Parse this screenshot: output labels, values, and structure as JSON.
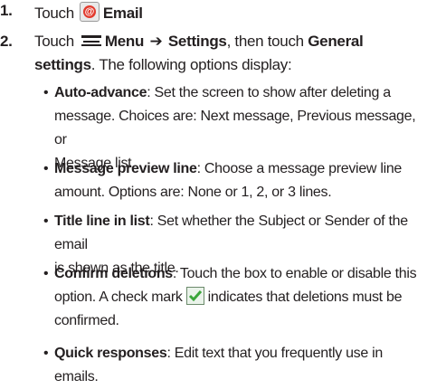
{
  "steps": [
    {
      "number": "1.",
      "pre": "Touch",
      "bold": "Email",
      "icon": "email-app-icon",
      "icon_glyph": "@"
    },
    {
      "number": "2.",
      "pre": "Touch",
      "menu_label": "Menu",
      "arrow": "➔",
      "settings": "Settings",
      "mid": ", then touch",
      "general": "General",
      "line2_bold": "settings",
      "line2_rest": ". The following options display:",
      "icon": "menu-icon"
    }
  ],
  "options": [
    {
      "bullet": "•",
      "term": "Auto-advance",
      "line1": ": Set the screen to show after deleting a",
      "line2": "message. Choices are: Next message, Previous message, or",
      "line3": "Message list."
    },
    {
      "bullet": "•",
      "term": "Message preview line",
      "line1": ": Choose a message preview line",
      "line2": "amount. Options are: None or 1, 2, or 3 lines."
    },
    {
      "bullet": "•",
      "term": "Title line in list",
      "line1": ": Set whether the Subject or Sender of the email",
      "line2": "is shown as the title."
    },
    {
      "bullet": "•",
      "term": "Confirm deletions",
      "line1": ": Touch the box to enable or disable this",
      "line2_pre": "option. A check mark",
      "line2_post": "indicates that deletions must be",
      "line3": "confirmed.",
      "icon": "checkmark-icon"
    },
    {
      "bullet": "•",
      "term": "Quick responses",
      "line1": ": Edit text that you frequently use in emails."
    }
  ]
}
